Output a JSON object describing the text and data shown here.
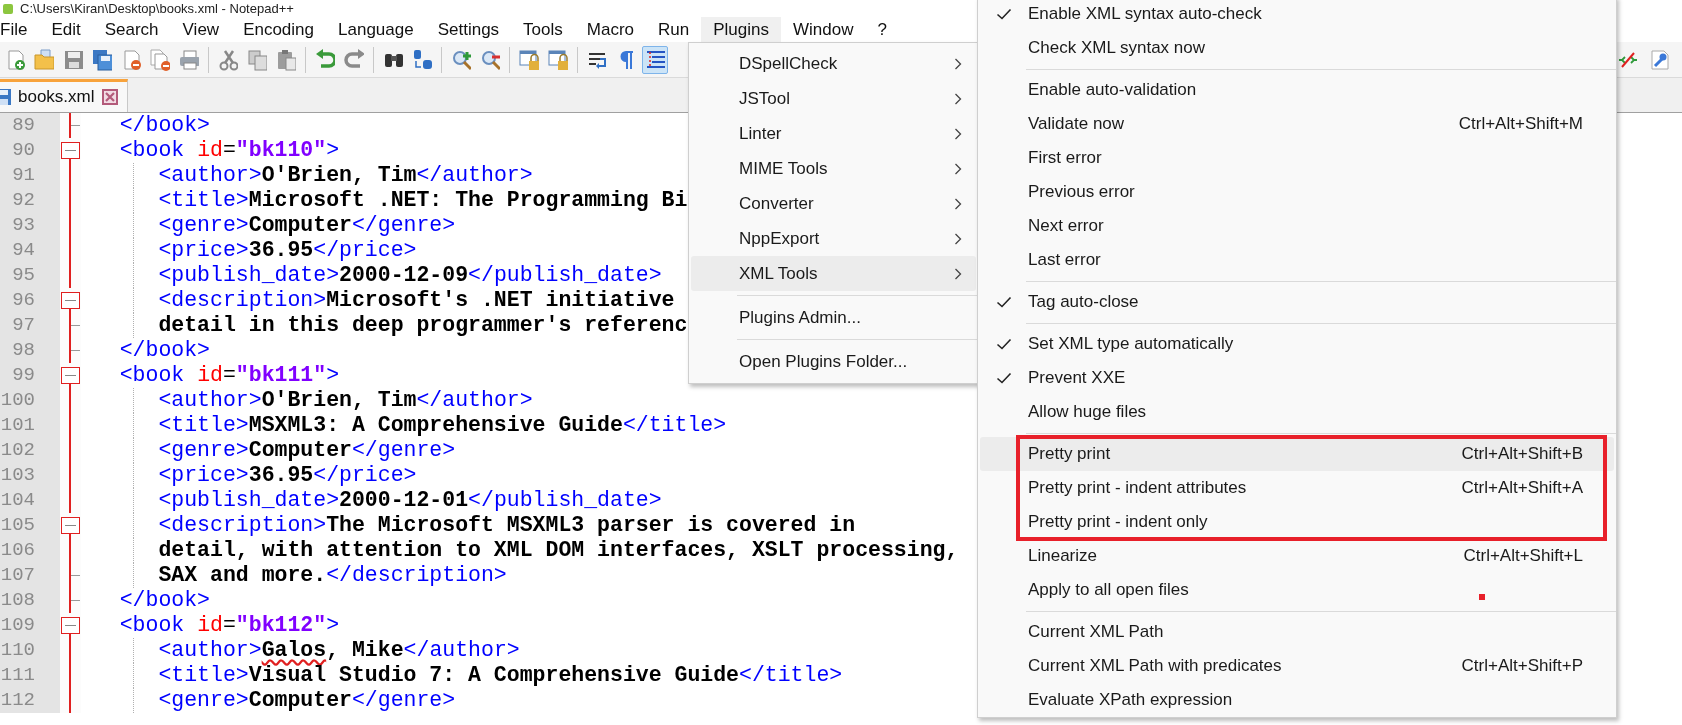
{
  "window": {
    "title": "C:\\Users\\Kiran\\Desktop\\books.xml - Notepad++"
  },
  "menu_bar": [
    {
      "label": "File",
      "selected": false
    },
    {
      "label": "Edit",
      "selected": false
    },
    {
      "label": "Search",
      "selected": false
    },
    {
      "label": "View",
      "selected": false
    },
    {
      "label": "Encoding",
      "selected": false
    },
    {
      "label": "Language",
      "selected": false
    },
    {
      "label": "Settings",
      "selected": false
    },
    {
      "label": "Tools",
      "selected": false
    },
    {
      "label": "Macro",
      "selected": false
    },
    {
      "label": "Run",
      "selected": false
    },
    {
      "label": "Plugins",
      "selected": true
    },
    {
      "label": "Window",
      "selected": false
    },
    {
      "label": "?",
      "selected": false
    }
  ],
  "toolbar": [
    {
      "kind": "new",
      "pressed": false
    },
    {
      "kind": "open",
      "pressed": false
    },
    {
      "kind": "save",
      "pressed": false
    },
    {
      "kind": "saveall",
      "pressed": false
    },
    {
      "kind": "close",
      "pressed": false
    },
    {
      "kind": "closeall",
      "pressed": false
    },
    {
      "kind": "print",
      "pressed": false
    },
    {
      "kind": "separator"
    },
    {
      "kind": "cut",
      "pressed": false
    },
    {
      "kind": "copy",
      "pressed": false
    },
    {
      "kind": "paste",
      "pressed": false
    },
    {
      "kind": "separator"
    },
    {
      "kind": "undo",
      "pressed": false
    },
    {
      "kind": "redo",
      "pressed": false
    },
    {
      "kind": "separator"
    },
    {
      "kind": "find",
      "pressed": false
    },
    {
      "kind": "replace",
      "pressed": false
    },
    {
      "kind": "separator"
    },
    {
      "kind": "zoomin",
      "pressed": false
    },
    {
      "kind": "zoomout",
      "pressed": false
    },
    {
      "kind": "separator"
    },
    {
      "kind": "syncv",
      "pressed": false
    },
    {
      "kind": "synch",
      "pressed": false
    },
    {
      "kind": "separator"
    },
    {
      "kind": "wrap",
      "pressed": false
    },
    {
      "kind": "pilcrow",
      "pressed": false
    },
    {
      "kind": "indentguide",
      "pressed": true
    }
  ],
  "toolbar_right": [
    {
      "kind": "striketag",
      "pressed": false
    },
    {
      "kind": "wrench",
      "pressed": false
    }
  ],
  "tabs": [
    {
      "label": "books.xml",
      "selected": true
    }
  ],
  "editor": {
    "lines": [
      {
        "number": "89",
        "fold_start": false,
        "fold_end": true,
        "guide": false,
        "tokens": [
          {
            "kind": "tag",
            "text": "   </book>"
          }
        ]
      },
      {
        "number": "90",
        "fold_start": true,
        "fold_end": false,
        "guide": false,
        "tokens": [
          {
            "kind": "tag",
            "text": "   <book "
          },
          {
            "kind": "attr",
            "text": "id"
          },
          {
            "kind": "plain",
            "text": "="
          },
          {
            "kind": "value",
            "text": "\"bk110\""
          },
          {
            "kind": "tag",
            "text": ">"
          }
        ]
      },
      {
        "number": "91",
        "fold_start": false,
        "fold_end": false,
        "guide": true,
        "tokens": [
          {
            "kind": "tag",
            "text": "      <author>"
          },
          {
            "kind": "text",
            "text": "O'Brien, Tim"
          },
          {
            "kind": "tag",
            "text": "</author>"
          }
        ]
      },
      {
        "number": "92",
        "fold_start": false,
        "fold_end": false,
        "guide": true,
        "tokens": [
          {
            "kind": "tag",
            "text": "      <title>"
          },
          {
            "kind": "text",
            "text": "Microsoft .NET: The Programming Bi"
          }
        ]
      },
      {
        "number": "93",
        "fold_start": false,
        "fold_end": false,
        "guide": true,
        "tokens": [
          {
            "kind": "tag",
            "text": "      <genre>"
          },
          {
            "kind": "text",
            "text": "Computer"
          },
          {
            "kind": "tag",
            "text": "</genre>"
          }
        ]
      },
      {
        "number": "94",
        "fold_start": false,
        "fold_end": false,
        "guide": true,
        "tokens": [
          {
            "kind": "tag",
            "text": "      <price>"
          },
          {
            "kind": "text",
            "text": "36.95"
          },
          {
            "kind": "tag",
            "text": "</price>"
          }
        ]
      },
      {
        "number": "95",
        "fold_start": false,
        "fold_end": false,
        "guide": true,
        "tokens": [
          {
            "kind": "tag",
            "text": "      <publish_date>"
          },
          {
            "kind": "text",
            "text": "2000-12-09"
          },
          {
            "kind": "tag",
            "text": "</publish_date>"
          }
        ]
      },
      {
        "number": "96",
        "fold_start": true,
        "fold_end": false,
        "guide": true,
        "tokens": [
          {
            "kind": "tag",
            "text": "      <description>"
          },
          {
            "kind": "text",
            "text": "Microsoft's .NET initiative"
          }
        ]
      },
      {
        "number": "97",
        "fold_start": false,
        "fold_end": true,
        "guide": true,
        "tokens": [
          {
            "kind": "text",
            "text": "      detail in this deep programmer's referenc"
          }
        ]
      },
      {
        "number": "98",
        "fold_start": false,
        "fold_end": true,
        "guide": false,
        "tokens": [
          {
            "kind": "tag",
            "text": "   </book>"
          }
        ]
      },
      {
        "number": "99",
        "fold_start": true,
        "fold_end": false,
        "guide": false,
        "tokens": [
          {
            "kind": "tag",
            "text": "   <book "
          },
          {
            "kind": "attr",
            "text": "id"
          },
          {
            "kind": "plain",
            "text": "="
          },
          {
            "kind": "value",
            "text": "\"bk111\""
          },
          {
            "kind": "tag",
            "text": ">"
          }
        ]
      },
      {
        "number": "100",
        "fold_start": false,
        "fold_end": false,
        "guide": true,
        "tokens": [
          {
            "kind": "tag",
            "text": "      <author>"
          },
          {
            "kind": "text",
            "text": "O'Brien, Tim"
          },
          {
            "kind": "tag",
            "text": "</author>"
          }
        ]
      },
      {
        "number": "101",
        "fold_start": false,
        "fold_end": false,
        "guide": true,
        "tokens": [
          {
            "kind": "tag",
            "text": "      <title>"
          },
          {
            "kind": "text",
            "text": "MSXML3: A Comprehensive Guide"
          },
          {
            "kind": "tag",
            "text": "</title>"
          }
        ]
      },
      {
        "number": "102",
        "fold_start": false,
        "fold_end": false,
        "guide": true,
        "tokens": [
          {
            "kind": "tag",
            "text": "      <genre>"
          },
          {
            "kind": "text",
            "text": "Computer"
          },
          {
            "kind": "tag",
            "text": "</genre>"
          }
        ]
      },
      {
        "number": "103",
        "fold_start": false,
        "fold_end": false,
        "guide": true,
        "tokens": [
          {
            "kind": "tag",
            "text": "      <price>"
          },
          {
            "kind": "text",
            "text": "36.95"
          },
          {
            "kind": "tag",
            "text": "</price>"
          }
        ]
      },
      {
        "number": "104",
        "fold_start": false,
        "fold_end": false,
        "guide": true,
        "tokens": [
          {
            "kind": "tag",
            "text": "      <publish_date>"
          },
          {
            "kind": "text",
            "text": "2000-12-01"
          },
          {
            "kind": "tag",
            "text": "</publish_date>"
          }
        ]
      },
      {
        "number": "105",
        "fold_start": true,
        "fold_end": false,
        "guide": true,
        "tokens": [
          {
            "kind": "tag",
            "text": "      <description>"
          },
          {
            "kind": "text",
            "text": "The Microsoft MSXML3 parser is covered in"
          }
        ]
      },
      {
        "number": "106",
        "fold_start": false,
        "fold_end": false,
        "guide": true,
        "tokens": [
          {
            "kind": "text",
            "text": "      detail, with attention to XML DOM interfaces, XSLT processing,"
          }
        ]
      },
      {
        "number": "107",
        "fold_start": false,
        "fold_end": true,
        "guide": true,
        "tokens": [
          {
            "kind": "text",
            "text": "      SAX and more."
          },
          {
            "kind": "tag",
            "text": "</description>"
          }
        ]
      },
      {
        "number": "108",
        "fold_start": false,
        "fold_end": true,
        "guide": false,
        "tokens": [
          {
            "kind": "tag",
            "text": "   </book>"
          }
        ]
      },
      {
        "number": "109",
        "fold_start": true,
        "fold_end": false,
        "guide": false,
        "tokens": [
          {
            "kind": "tag",
            "text": "   <book "
          },
          {
            "kind": "attr",
            "text": "id"
          },
          {
            "kind": "plain",
            "text": "="
          },
          {
            "kind": "value",
            "text": "\"bk112\""
          },
          {
            "kind": "tag",
            "text": ">"
          }
        ]
      },
      {
        "number": "110",
        "fold_start": false,
        "fold_end": false,
        "guide": true,
        "tokens": [
          {
            "kind": "tag",
            "text": "      <author>"
          },
          {
            "kind": "misspelled",
            "text": "Galos"
          },
          {
            "kind": "text",
            "text": ", Mike"
          },
          {
            "kind": "tag",
            "text": "</author>"
          }
        ]
      },
      {
        "number": "111",
        "fold_start": false,
        "fold_end": false,
        "guide": true,
        "tokens": [
          {
            "kind": "tag",
            "text": "      <title>"
          },
          {
            "kind": "text",
            "text": "Visual Studio 7: A Comprehensive Guide"
          },
          {
            "kind": "tag",
            "text": "</title>"
          }
        ]
      },
      {
        "number": "112",
        "fold_start": false,
        "fold_end": false,
        "guide": true,
        "tokens": [
          {
            "kind": "tag",
            "text": "      <genre>"
          },
          {
            "kind": "text",
            "text": "Computer"
          },
          {
            "kind": "tag",
            "text": "</genre>"
          }
        ]
      }
    ]
  },
  "plugins_menu": [
    {
      "kind": "item",
      "label": "DSpellCheck",
      "submenu": true,
      "highlighted": false
    },
    {
      "kind": "item",
      "label": "JSTool",
      "submenu": true,
      "highlighted": false
    },
    {
      "kind": "item",
      "label": "Linter",
      "submenu": true,
      "highlighted": false
    },
    {
      "kind": "item",
      "label": "MIME Tools",
      "submenu": true,
      "highlighted": false
    },
    {
      "kind": "item",
      "label": "Converter",
      "submenu": true,
      "highlighted": false
    },
    {
      "kind": "item",
      "label": "NppExport",
      "submenu": true,
      "highlighted": false
    },
    {
      "kind": "item",
      "label": "XML Tools",
      "submenu": true,
      "highlighted": true
    },
    {
      "kind": "separator"
    },
    {
      "kind": "item",
      "label": "Plugins Admin...",
      "submenu": false,
      "highlighted": false
    },
    {
      "kind": "separator"
    },
    {
      "kind": "item",
      "label": "Open Plugins Folder...",
      "submenu": false,
      "highlighted": false
    }
  ],
  "xml_tools_menu": [
    {
      "kind": "item",
      "label": "Enable XML syntax auto-check",
      "checked": true,
      "highlighted": false
    },
    {
      "kind": "item",
      "label": "Check XML syntax now",
      "checked": false,
      "highlighted": false
    },
    {
      "kind": "separator"
    },
    {
      "kind": "item",
      "label": "Enable auto-validation",
      "checked": false,
      "highlighted": false
    },
    {
      "kind": "item",
      "label": "Validate now",
      "shortcut": "Ctrl+Alt+Shift+M",
      "checked": false,
      "highlighted": false
    },
    {
      "kind": "item",
      "label": "First error",
      "checked": false,
      "highlighted": false
    },
    {
      "kind": "item",
      "label": "Previous error",
      "checked": false,
      "highlighted": false
    },
    {
      "kind": "item",
      "label": "Next error",
      "checked": false,
      "highlighted": false
    },
    {
      "kind": "item",
      "label": "Last error",
      "checked": false,
      "highlighted": false
    },
    {
      "kind": "separator"
    },
    {
      "kind": "item",
      "label": "Tag auto-close",
      "checked": true,
      "highlighted": false
    },
    {
      "kind": "separator"
    },
    {
      "kind": "item",
      "label": "Set XML type automatically",
      "checked": true,
      "highlighted": false
    },
    {
      "kind": "item",
      "label": "Prevent XXE",
      "checked": true,
      "highlighted": false
    },
    {
      "kind": "item",
      "label": "Allow huge files",
      "checked": false,
      "highlighted": false
    },
    {
      "kind": "separator"
    },
    {
      "kind": "item",
      "label": "Pretty print",
      "shortcut": "Ctrl+Alt+Shift+B",
      "checked": false,
      "highlighted": true
    },
    {
      "kind": "item",
      "label": "Pretty print - indent attributes",
      "shortcut": "Ctrl+Alt+Shift+A",
      "checked": false,
      "highlighted": false
    },
    {
      "kind": "item",
      "label": "Pretty print - indent only",
      "checked": false,
      "highlighted": false
    },
    {
      "kind": "item",
      "label": "Linearize",
      "shortcut": "Ctrl+Alt+Shift+L",
      "checked": false,
      "highlighted": false
    },
    {
      "kind": "item",
      "label": "Apply to all open files",
      "checked": false,
      "highlighted": false
    },
    {
      "kind": "separator"
    },
    {
      "kind": "item",
      "label": "Current XML Path",
      "checked": false,
      "highlighted": false
    },
    {
      "kind": "item",
      "label": "Current XML Path with predicates",
      "shortcut": "Ctrl+Alt+Shift+P",
      "checked": false,
      "highlighted": false
    },
    {
      "kind": "item",
      "label": "Evaluate XPath expression",
      "checked": false,
      "highlighted": false
    }
  ]
}
